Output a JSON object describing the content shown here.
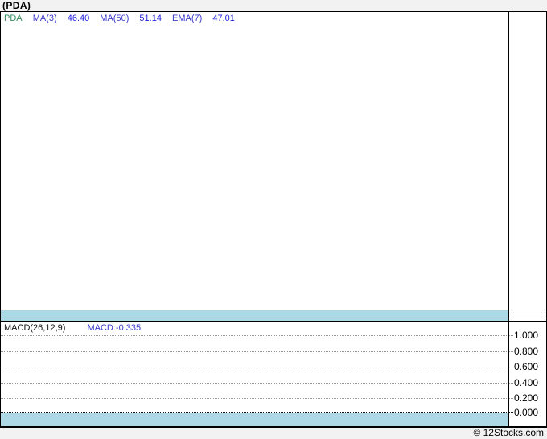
{
  "window": {
    "title": "(PDA)"
  },
  "price_panel": {
    "symbol": "PDA",
    "ma3_label": "MA(3)",
    "ma3_value": "46.40",
    "ma50_label": "MA(50)",
    "ma50_value": "51.14",
    "ema7_label": "EMA(7)",
    "ema7_value": "47.01"
  },
  "macd_panel": {
    "indicator_label": "MACD(26,12,9)",
    "value_label": "MACD:-0.335",
    "axis_labels": [
      "1.000",
      "0.800",
      "0.600",
      "0.400",
      "0.200",
      "0.000"
    ]
  },
  "footer": {
    "credit": "© 12Stocks.com"
  },
  "colors": {
    "strip_blue": "#add8e6",
    "symbol_green": "#2e8b57",
    "indicator_label_blue": "#3a3acc",
    "indicator_value_blue": "#2424dd",
    "background_gray": "#f2f2f2",
    "gridline_gray": "#999999",
    "border_black": "#000000"
  },
  "chart_data": [
    {
      "type": "line",
      "title": "PDA price panel",
      "series": [],
      "annotations": [
        "PDA",
        "MA(3) 46.40",
        "MA(50) 51.14",
        "EMA(7) 47.01"
      ],
      "note": "no price data plotted; panel is empty"
    },
    {
      "type": "bar",
      "title": "MACD(26,12,9)",
      "current_value": -0.335,
      "ylim": [
        0.0,
        1.0
      ],
      "yticks": [
        1.0,
        0.8,
        0.6,
        0.4,
        0.2,
        0.0
      ],
      "legend_position": "top-left",
      "grid": true,
      "series": [],
      "note": "no MACD series plotted; axis and dotted gridlines only"
    }
  ]
}
